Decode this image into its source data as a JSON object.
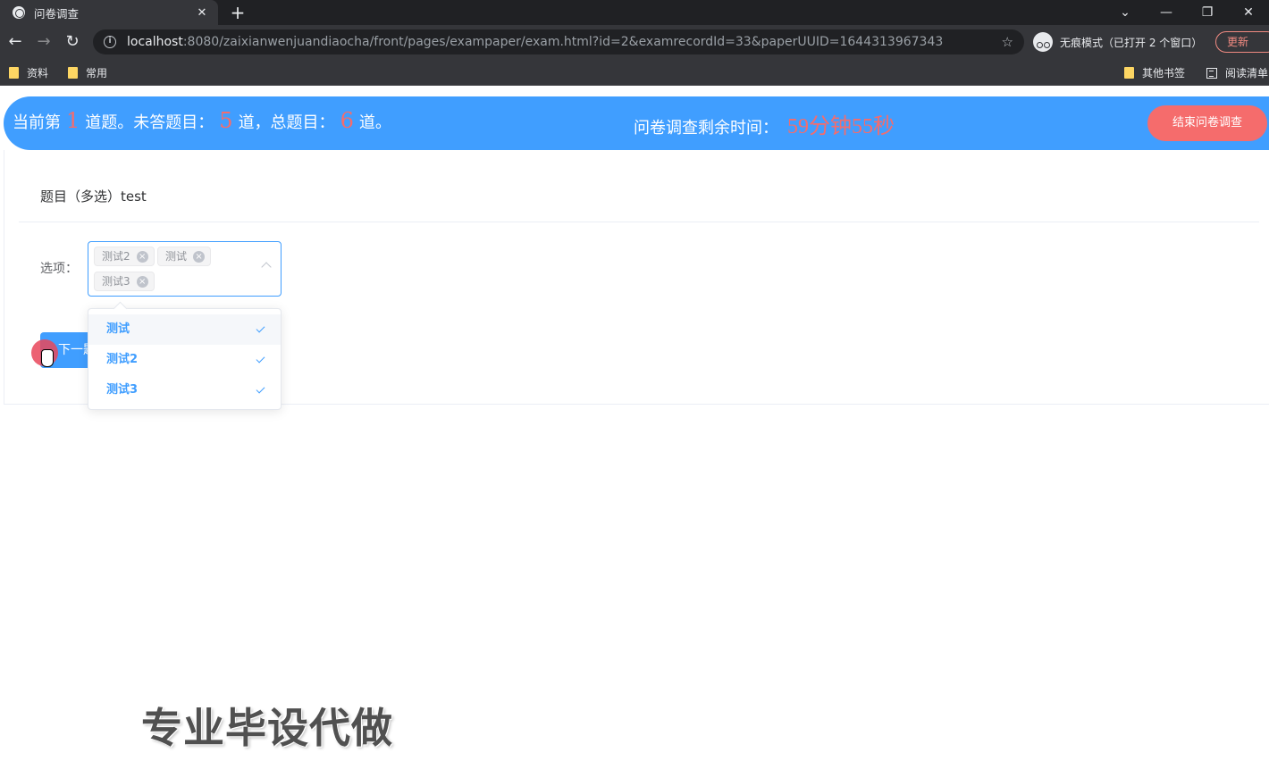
{
  "browser": {
    "tab_title": "问卷调查",
    "tab_close": "✕",
    "new_tab": "+",
    "url_host": "localhost",
    "url_rest": ":8080/zaixianwenjuandiaocha/front/pages/exampaper/exam.html?id=2&examrecordId=33&paperUUID=1644313967343",
    "incognito_label": "无痕模式（已打开 2 个窗口）",
    "update_label": "更新",
    "bookmarks": [
      "资料",
      "常用",
      "其他书签",
      "阅读清单"
    ]
  },
  "exam": {
    "status_prefix": "当前第",
    "current_index": "1",
    "status_mid1": "道题。未答题目：",
    "unanswered": "5",
    "status_mid2": "道，总题目：",
    "total": "6",
    "status_suffix": "道。",
    "timer_label": "问卷调查剩余时间：",
    "timer_value": "59分钟55秒",
    "end_button": "结束问卷调查"
  },
  "question": {
    "title": "题目（多选）test",
    "options_label": "选项：",
    "selected_tags": [
      "测试2",
      "测试",
      "测试3"
    ],
    "dropdown_options": [
      "测试",
      "测试2",
      "测试3"
    ],
    "next_button": "下一题"
  },
  "watermark": "专业毕设代做",
  "colors": {
    "primary": "#409eff",
    "danger": "#f56c6c",
    "browser_bg": "#35363a"
  }
}
